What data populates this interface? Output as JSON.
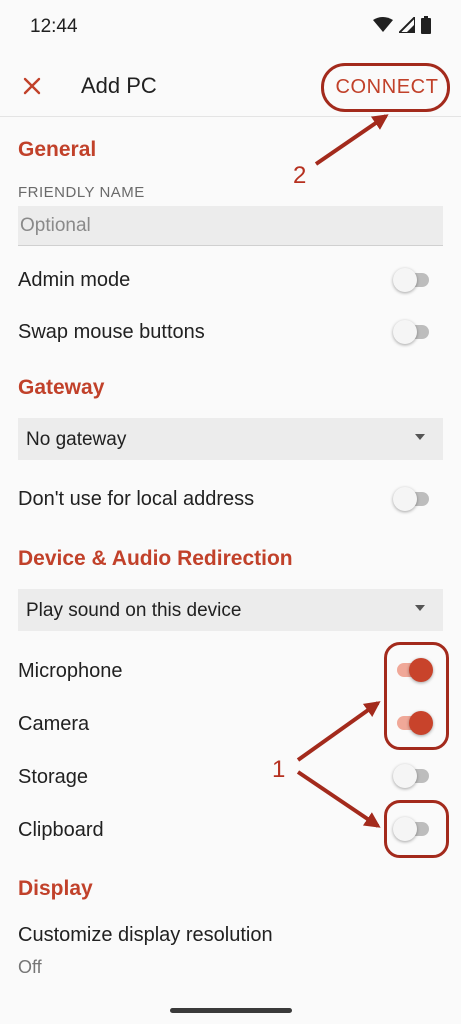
{
  "status_bar": {
    "time": "12:44"
  },
  "app_bar": {
    "title": "Add PC",
    "connect_label": "CONNECT"
  },
  "general": {
    "section_title": "General",
    "friendly_name_label": "FRIENDLY NAME",
    "friendly_name_value": "",
    "friendly_name_placeholder": "Optional",
    "admin_mode": {
      "label": "Admin mode",
      "on": false
    },
    "swap_mouse": {
      "label": "Swap mouse buttons",
      "on": false
    }
  },
  "gateway": {
    "section_title": "Gateway",
    "selected": "No gateway",
    "local_address": {
      "label": "Don't use for local address",
      "on": false
    }
  },
  "redirection": {
    "section_title": "Device & Audio Redirection",
    "sound_selected": "Play sound on this device",
    "microphone": {
      "label": "Microphone",
      "on": true
    },
    "camera": {
      "label": "Camera",
      "on": true
    },
    "storage": {
      "label": "Storage",
      "on": false
    },
    "clipboard": {
      "label": "Clipboard",
      "on": false
    }
  },
  "display": {
    "section_title": "Display",
    "resolution_label": "Customize display resolution",
    "resolution_value": "Off"
  },
  "annotations": {
    "one": "1",
    "two": "2"
  },
  "colors": {
    "accent": "#c1412a",
    "annotation": "#a32a1c",
    "switch_on": "#c8432b"
  },
  "icons": [
    "wifi-icon",
    "signal-icon",
    "battery-icon",
    "close-icon",
    "dropdown-arrow-icon"
  ]
}
